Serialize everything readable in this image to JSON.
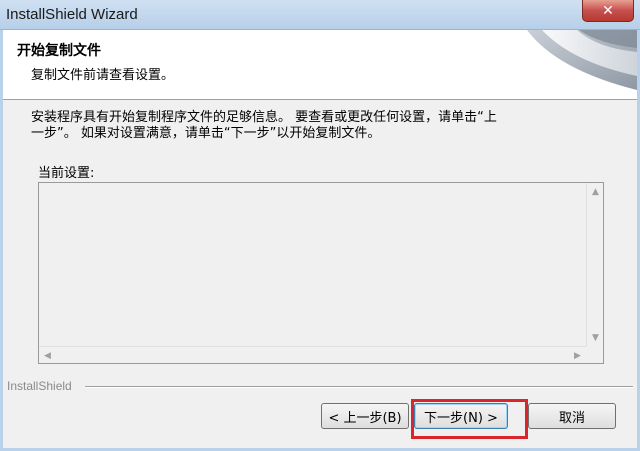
{
  "window": {
    "title": "InstallShield Wizard",
    "close_symbol": "✕"
  },
  "header": {
    "title": "开始复制文件",
    "subtitle": "复制文件前请查看设置。"
  },
  "body": {
    "intro_line1": "安装程序具有开始复制程序文件的足够信息。  要查看或更改任何设置，请单击“上",
    "intro_line2": "一步”。  如果对设置满意，请单击“下一步”以开始复制文件。",
    "settings_label": "当前设置:",
    "settings_content": ""
  },
  "footer": {
    "brand": "InstallShield"
  },
  "buttons": {
    "back": "< 上一步(B)",
    "next": "下一步(N) >",
    "cancel": "取消"
  },
  "icons": {
    "close": "close-icon",
    "scroll_up": "chevron-up-icon",
    "scroll_down": "chevron-down-icon",
    "scroll_left": "chevron-left-icon",
    "scroll_right": "chevron-right-icon"
  },
  "colors": {
    "highlight": "#d9262c",
    "window_frame": "#b9d1ea",
    "close_button": "#c75050"
  }
}
